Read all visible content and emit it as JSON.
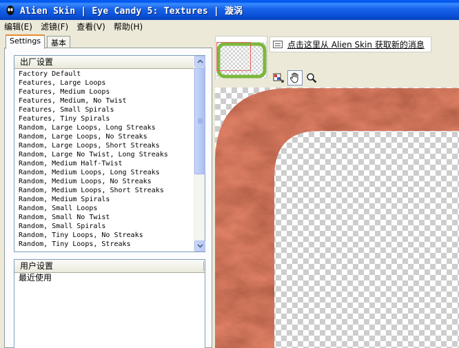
{
  "window": {
    "title": "Alien Skin | Eye Candy 5: Textures | 漩涡"
  },
  "menu": [
    {
      "label": "编辑(E)"
    },
    {
      "label": "滤镜(F)"
    },
    {
      "label": "查看(V)"
    },
    {
      "label": "帮助(H)"
    }
  ],
  "tabs": [
    {
      "label": "Settings",
      "active": true
    },
    {
      "label": "基本",
      "active": false
    }
  ],
  "presets": {
    "header": "出厂设置",
    "items": [
      "Factory Default",
      "Features, Large Loops",
      "Features, Medium Loops",
      "Features, Medium, No Twist",
      "Features, Small Spirals",
      "Features, Tiny Spirals",
      "Random, Large Loops, Long Streaks",
      "Random, Large Loops, No Streaks",
      "Random, Large Loops, Short Streaks",
      "Random, Large No Twist, Long Streaks",
      "Random, Medium Half-Twist",
      "Random, Medium Loops, Long Streaks",
      "Random, Medium Loops, No Streaks",
      "Random, Medium Loops, Short Streaks",
      "Random, Medium Spirals",
      "Random, Small Loops",
      "Random, Small No Twist",
      "Random, Small Spirals",
      "Random, Tiny Loops, No Streaks",
      "Random, Tiny Loops, Streaks"
    ]
  },
  "user_settings": {
    "header": "用户设置",
    "items": [
      "最近使用"
    ]
  },
  "news": {
    "link_text": "点击这里从 Alien Skin 获取新的消息"
  },
  "tools": [
    {
      "icon": "preview-toggle-icon",
      "active": false
    },
    {
      "icon": "hand-pan-icon",
      "active": true
    },
    {
      "icon": "zoom-magnifier-icon",
      "active": false
    }
  ],
  "colors": {
    "titlebar": "#0a5cf0",
    "texture": "#a0402a",
    "thumb_frame": "#7cb83c",
    "thumb_selection": "#e06060"
  }
}
